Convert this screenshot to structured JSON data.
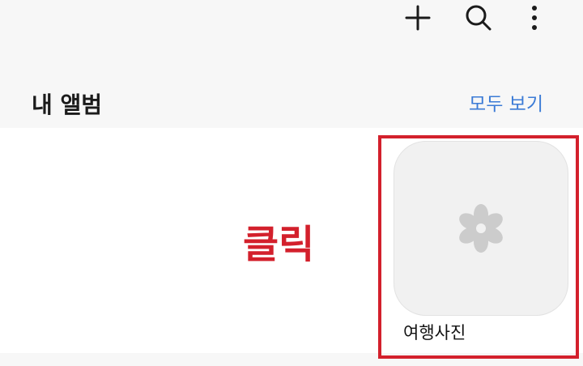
{
  "toolbar": {
    "add_icon": "plus-icon",
    "search_icon": "search-icon",
    "more_icon": "more-vertical-icon"
  },
  "albums_section": {
    "title": "내 앨범",
    "view_all_label": "모두 보기"
  },
  "albums": [
    {
      "name": "여행사진",
      "thumbnail_icon": "flower-placeholder-icon"
    }
  ],
  "annotation": {
    "text": "클릭",
    "color": "#d3202c"
  },
  "colors": {
    "accent_link": "#3b7bd6",
    "placeholder_icon": "#cccccc",
    "highlight": "#d3202c"
  }
}
